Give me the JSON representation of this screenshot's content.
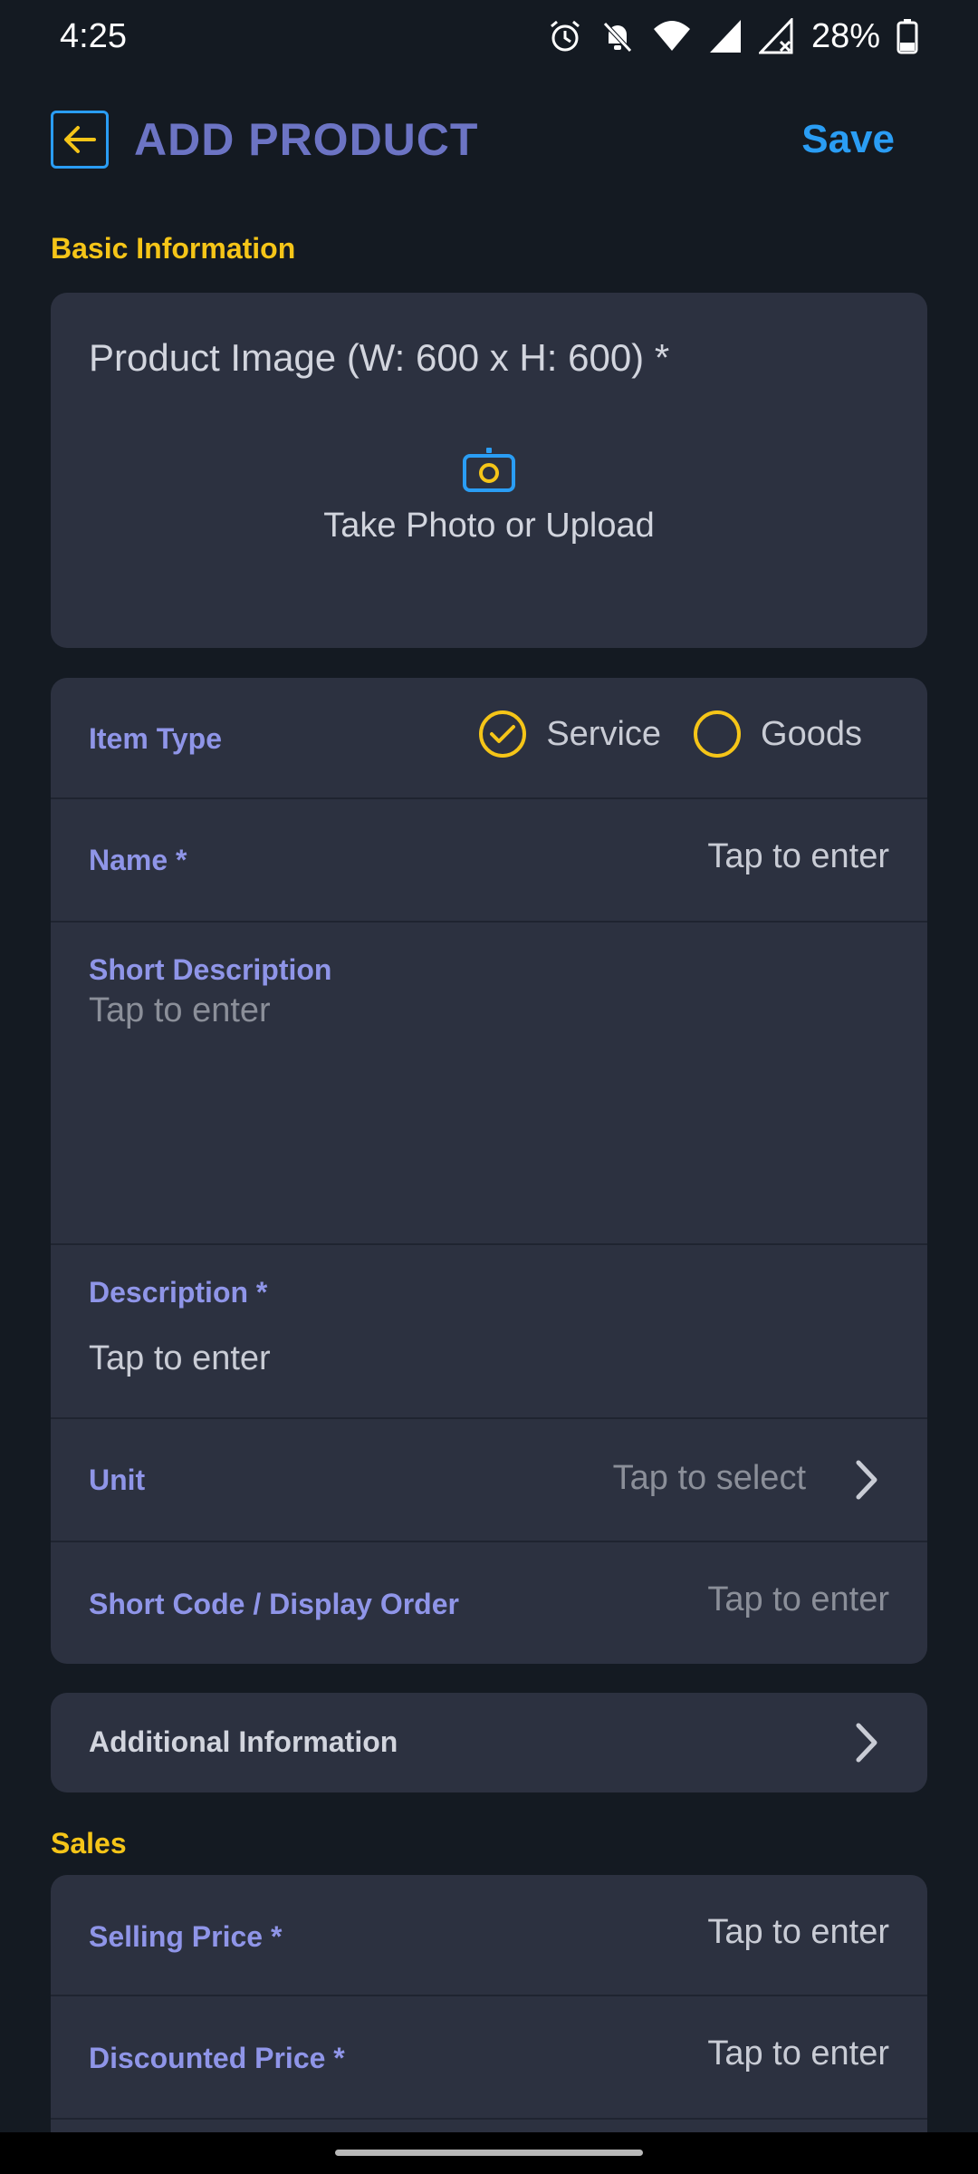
{
  "status_bar": {
    "time": "4:25",
    "battery": "28%"
  },
  "app_bar": {
    "title": "ADD PRODUCT",
    "save_label": "Save"
  },
  "sections": {
    "basic": "Basic Information",
    "sales": "Sales"
  },
  "product_image": {
    "label": "Product Image (W: 600 x H: 600) *",
    "upload_text": "Take Photo or Upload"
  },
  "item_type": {
    "label": "Item Type",
    "options": [
      {
        "label": "Service",
        "selected": true
      },
      {
        "label": "Goods",
        "selected": false
      }
    ]
  },
  "name": {
    "label": "Name *",
    "placeholder": "Tap to enter"
  },
  "short_description": {
    "label": "Short Description",
    "placeholder": "Tap to enter"
  },
  "description": {
    "label": "Description *",
    "placeholder": "Tap to enter"
  },
  "unit": {
    "label": "Unit",
    "placeholder": "Tap to select"
  },
  "short_code": {
    "label": "Short Code / Display Order",
    "placeholder": "Tap to enter"
  },
  "additional_info": {
    "label": "Additional Information"
  },
  "selling_price": {
    "label": "Selling Price *",
    "placeholder": "Tap to enter"
  },
  "discounted_price": {
    "label": "Discounted Price *",
    "placeholder": "Tap to enter"
  },
  "colors": {
    "accent_yellow": "#f5c518",
    "accent_blue": "#2a9df4",
    "label_purple": "#8f95e8",
    "card_bg": "#2c3140",
    "page_bg": "#141a22"
  },
  "icons": [
    "alarm-icon",
    "bell-off-icon",
    "wifi-icon",
    "signal-icon",
    "signal-x-icon",
    "battery-icon",
    "arrow-left-icon",
    "camera-icon",
    "check-icon",
    "chevron-right-icon"
  ]
}
